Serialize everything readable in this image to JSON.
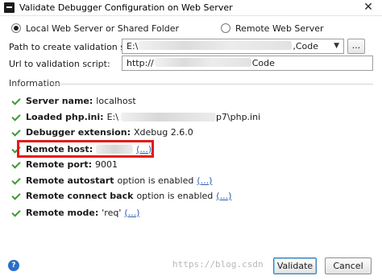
{
  "window": {
    "title": "Validate Debugger Configuration on Web Server",
    "close_symbol": "✕"
  },
  "server_type": {
    "options": [
      {
        "label": "Local Web Server or Shared Folder",
        "selected": true
      },
      {
        "label": "Remote Web Server",
        "selected": false
      }
    ]
  },
  "form": {
    "path_label": "Path to create validation script:",
    "path_value_prefix": "E:\\",
    "path_value_suffix": ",Code",
    "browse_label": "...",
    "url_label": "Url to validation script:",
    "url_value_prefix": "http://",
    "url_value_suffix": "Code"
  },
  "information": {
    "section_title": "Information",
    "server_name": {
      "label": "Server name:",
      "value": "localhost"
    },
    "php_ini": {
      "label": "Loaded php.ini:",
      "value_prefix": "E:\\",
      "value_suffix": "p7\\php.ini"
    },
    "debugger_extension": {
      "label": "Debugger extension:",
      "value": "Xdebug 2.6.0"
    },
    "remote_host": {
      "label": "Remote host:",
      "link": "(...)"
    },
    "remote_port": {
      "label": "Remote port:",
      "value": "9001"
    },
    "remote_autostart": {
      "label": "Remote autostart",
      "value": "option is enabled",
      "link": "(...)"
    },
    "remote_connect_back": {
      "label": "Remote connect back",
      "value": "option is enabled",
      "link": "(...)"
    },
    "remote_mode": {
      "label": "Remote mode:",
      "value": "'req'",
      "link": "(...)"
    }
  },
  "footer": {
    "help_symbol": "?",
    "watermark": "https://blog.csdn",
    "validate_label": "Validate",
    "cancel_label": "Cancel"
  },
  "colors": {
    "check": "#3d9a32",
    "link": "#2a5db0",
    "highlight": "#e41a1a",
    "help": "#2a6fc9"
  }
}
